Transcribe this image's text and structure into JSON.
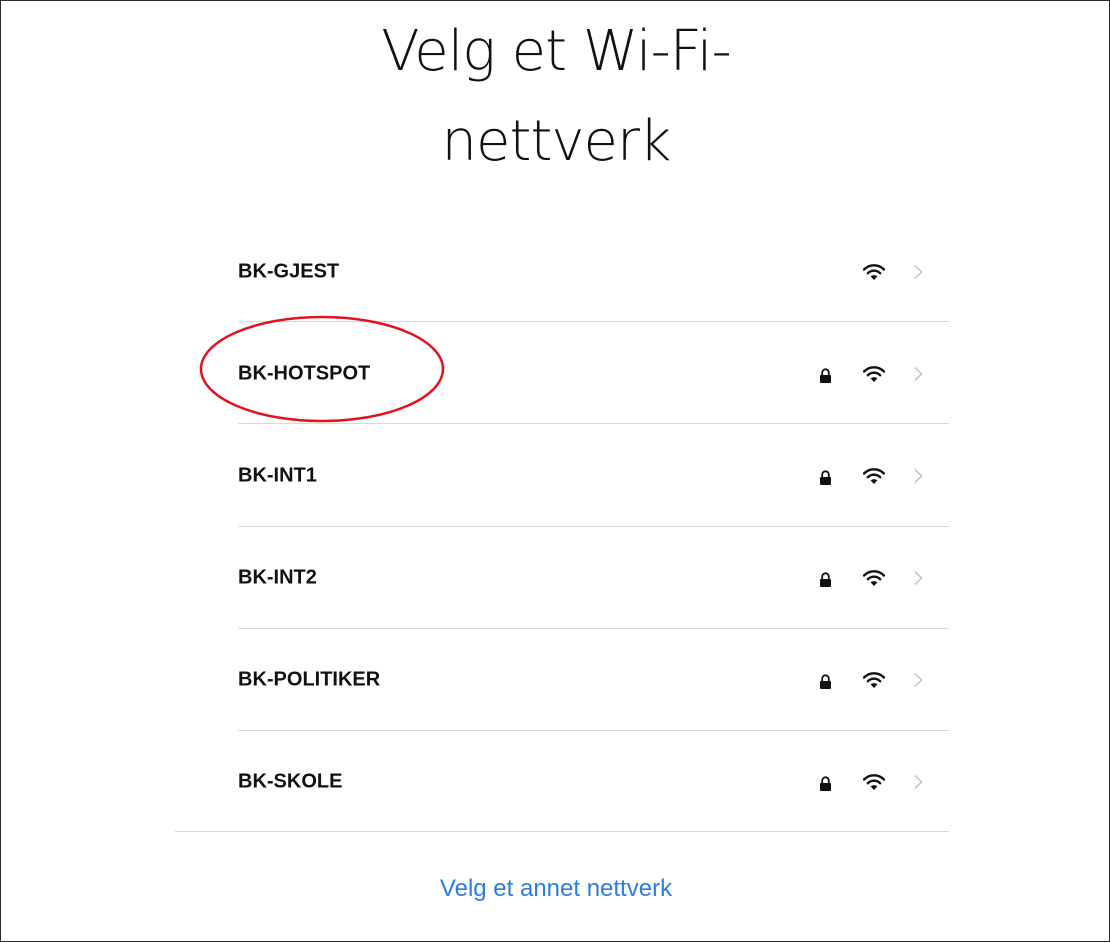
{
  "title": {
    "line1": "Velg et Wi-Fi-",
    "line2": "nettverk"
  },
  "networks": [
    {
      "name": "BK-GJEST",
      "secured": false,
      "icon": "wifi-icon"
    },
    {
      "name": "BK-HOTSPOT",
      "secured": true,
      "icon": "wifi-icon"
    },
    {
      "name": "BK-INT1",
      "secured": true,
      "icon": "wifi-icon"
    },
    {
      "name": "BK-INT2",
      "secured": true,
      "icon": "wifi-icon"
    },
    {
      "name": "BK-POLITIKER",
      "secured": true,
      "icon": "wifi-icon"
    },
    {
      "name": "BK-SKOLE",
      "secured": true,
      "icon": "wifi-icon"
    }
  ],
  "other_network_label": "Velg et annet nettverk",
  "colors": {
    "link": "#2a7de1",
    "highlight": "#e0141e",
    "divider": "#d9d9d9",
    "chevron": "#c7c7cc"
  }
}
